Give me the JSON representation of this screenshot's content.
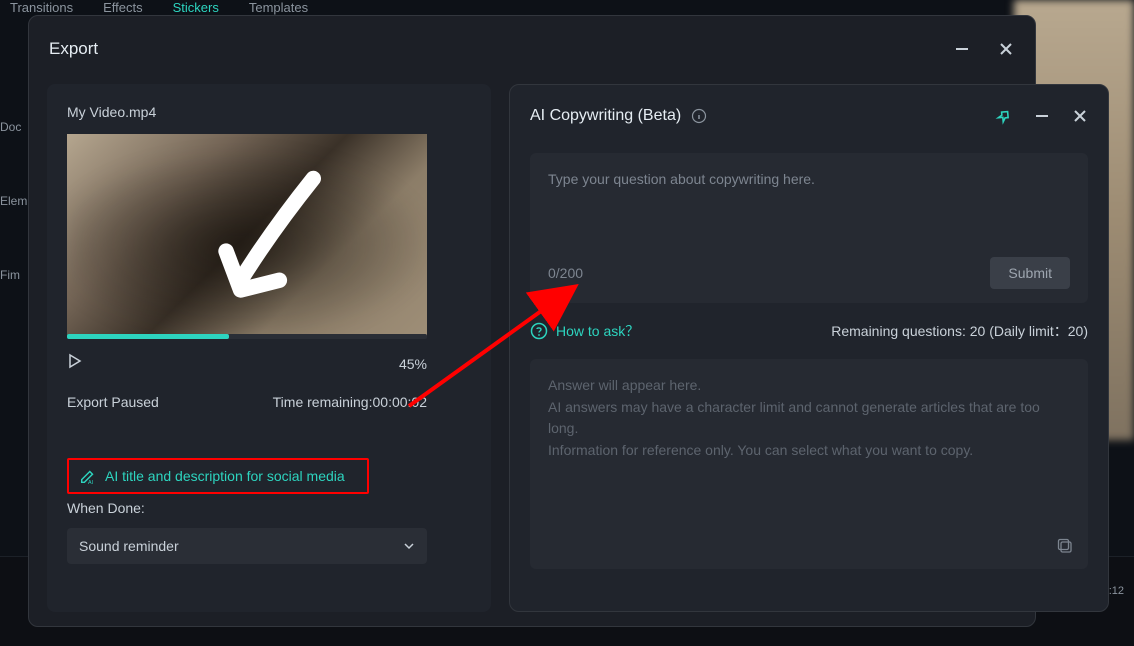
{
  "bg": {
    "tabs": [
      "Transitions",
      "Effects",
      "Stickers",
      "Templates"
    ],
    "sidebar": [
      "Doc",
      "",
      "Elem",
      "",
      "Fim"
    ],
    "timeline_time": ":12"
  },
  "dialog": {
    "title": "Export"
  },
  "export": {
    "filename": "My Video.mp4",
    "percent": "45%",
    "status": "Export Paused",
    "time_remaining_label": "Time remaining:",
    "time_remaining_value": "00:00:02",
    "ai_link": "AI title and description for social media",
    "when_done_label": "When Done:",
    "select_value": "Sound reminder"
  },
  "ai": {
    "title": "AI Copywriting (Beta)",
    "placeholder": "Type your question about copywriting here.",
    "counter": "0/200",
    "submit": "Submit",
    "howto": "How to ask？",
    "remaining": "Remaining questions: 20 (Daily limit：20)",
    "answer_ph1": "Answer will appear here.",
    "answer_ph2": "AI answers may have a character limit and cannot generate articles that are too long.",
    "answer_ph3": "Information for reference only. You can select what you want to copy."
  }
}
